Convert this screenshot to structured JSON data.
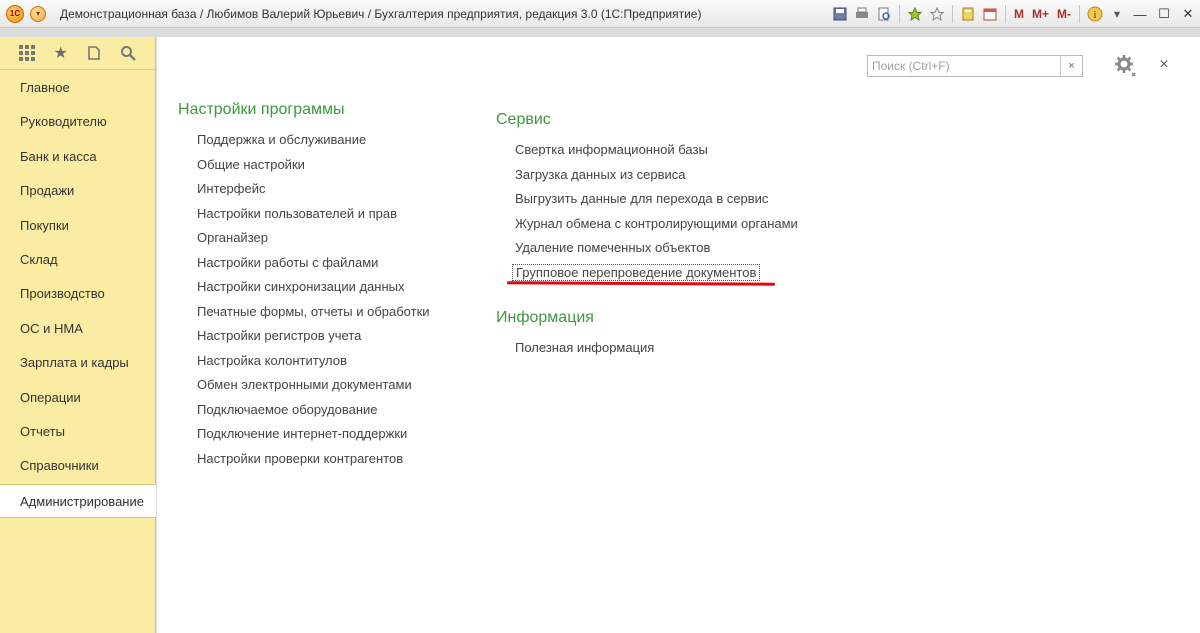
{
  "window": {
    "title": "Демонстрационная база / Любимов Валерий Юрьевич / Бухгалтерия предприятия, редакция 3.0  (1С:Предприятие)",
    "app_logo_text": "1С",
    "toolbar_icons": [
      "save-icon",
      "print-icon",
      "preview-icon",
      "favorites-icon",
      "history-icon",
      "calculator-icon",
      "calendar-icon"
    ],
    "m_buttons": [
      "M",
      "M+",
      "M-"
    ]
  },
  "sidebar": {
    "tools": [
      "apps-grid-icon",
      "star-icon",
      "history-icon",
      "search-icon"
    ],
    "items": [
      {
        "label": "Главное"
      },
      {
        "label": "Руководителю"
      },
      {
        "label": "Банк и касса"
      },
      {
        "label": "Продажи"
      },
      {
        "label": "Покупки"
      },
      {
        "label": "Склад"
      },
      {
        "label": "Производство"
      },
      {
        "label": "ОС и НМА"
      },
      {
        "label": "Зарплата и кадры"
      },
      {
        "label": "Операции"
      },
      {
        "label": "Отчеты"
      },
      {
        "label": "Справочники"
      },
      {
        "label": "Администрирование",
        "active": true
      }
    ]
  },
  "search": {
    "placeholder": "Поиск (Ctrl+F)",
    "clear_label": "×"
  },
  "main": {
    "close_label": "×",
    "program_settings": {
      "title": "Настройки программы",
      "links": [
        "Поддержка и обслуживание",
        "Общие настройки",
        "Интерфейс",
        "Настройки пользователей и прав",
        "Органайзер",
        "Настройки работы с файлами",
        "Настройки синхронизации данных",
        "Печатные формы, отчеты и обработки",
        "Настройки регистров учета",
        "Настройка колонтитулов",
        "Обмен электронными документами",
        "Подключаемое оборудование",
        "Подключение интернет-поддержки",
        "Настройки проверки контрагентов"
      ]
    },
    "service": {
      "title": "Сервис",
      "links": [
        "Свертка информационной базы",
        "Загрузка данных из сервиса",
        "Выгрузить данные для перехода в сервис",
        "Журнал обмена с контролирующими органами",
        "Удаление помеченных объектов",
        "Групповое перепроведение документов"
      ]
    },
    "info": {
      "title": "Информация",
      "links": [
        "Полезная информация"
      ]
    }
  },
  "colors": {
    "sidebar_bg": "#fbeca3",
    "section_title": "#3c9a3c",
    "highlight_underline": "#e30613"
  }
}
